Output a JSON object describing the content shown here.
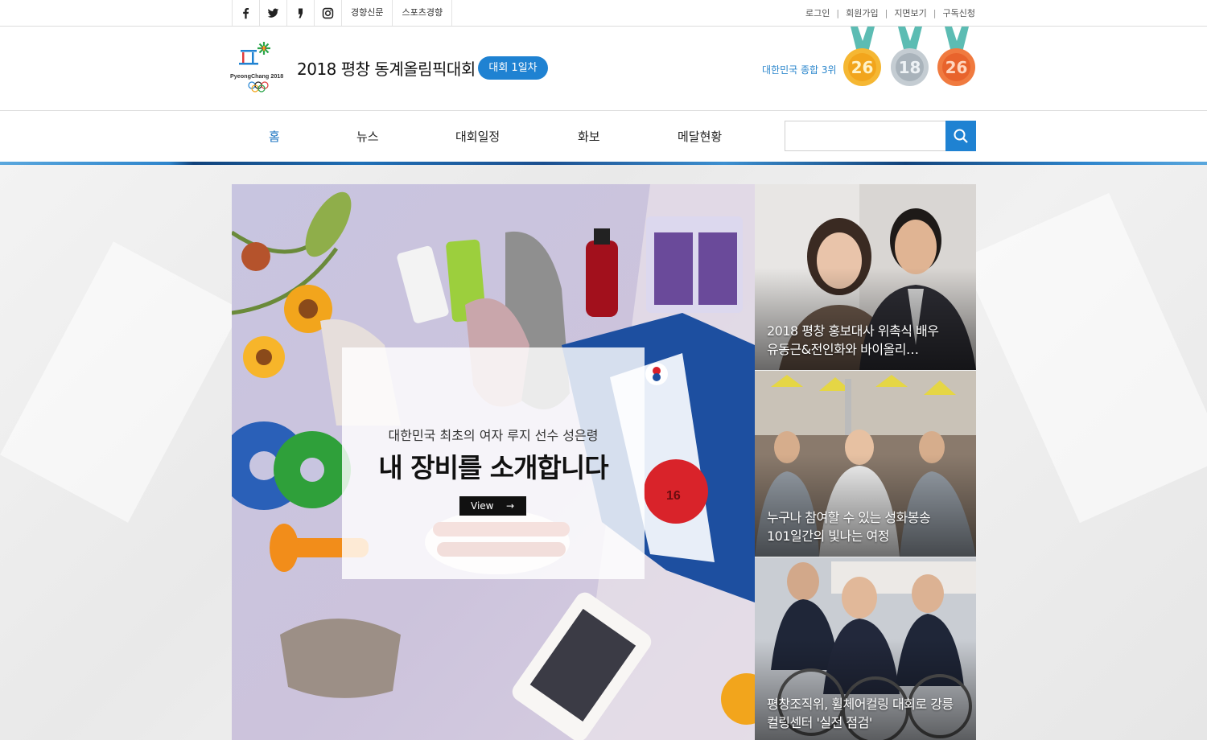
{
  "topbar": {
    "social": [
      "facebook-icon",
      "twitter-icon",
      "kakao-story-icon",
      "instagram-icon"
    ],
    "publications": [
      "경향신문",
      "스포츠경향"
    ],
    "links": [
      "로그인",
      "회원가입",
      "지면보기",
      "구독신청"
    ]
  },
  "header": {
    "title": "2018 평창 동계올림픽대회",
    "day_badge": "대회 1일차",
    "rank_text": "대한민국 종합 3위",
    "medals": [
      {
        "type": "gold",
        "count": "26",
        "color": "#f2a51c"
      },
      {
        "type": "silver",
        "count": "18",
        "color": "#a9b3bb"
      },
      {
        "type": "bronze",
        "count": "26",
        "color": "#e8632c"
      }
    ],
    "logo_text": "PyeongChang 2018"
  },
  "nav": {
    "items": [
      "홈",
      "뉴스",
      "대회일정",
      "화보",
      "메달현황"
    ],
    "active_index": 0,
    "search_placeholder": ""
  },
  "hero": {
    "subtitle": "대한민국 최초의 여자 루지 선수 성은령",
    "title": "내 장비를 소개합니다",
    "button_label": "View",
    "bib_number": "16"
  },
  "side_stories": [
    {
      "caption_line1": "2018 평창 홍보대사 위촉식 배우",
      "caption_line2": "유동근&전인화와 바이올리…"
    },
    {
      "caption_line1": "누구나 참여할 수 있는 성화봉송",
      "caption_line2": "101일간의 빛나는 여정"
    },
    {
      "caption_line1": "평창조직위, 휠체어컬링 대회로 강릉",
      "caption_line2": "컬링센터 '실전 점검'"
    }
  ],
  "colors": {
    "accent": "#1f82d2",
    "nav_active": "#1a73c0",
    "rank_text": "#2a86cc"
  }
}
